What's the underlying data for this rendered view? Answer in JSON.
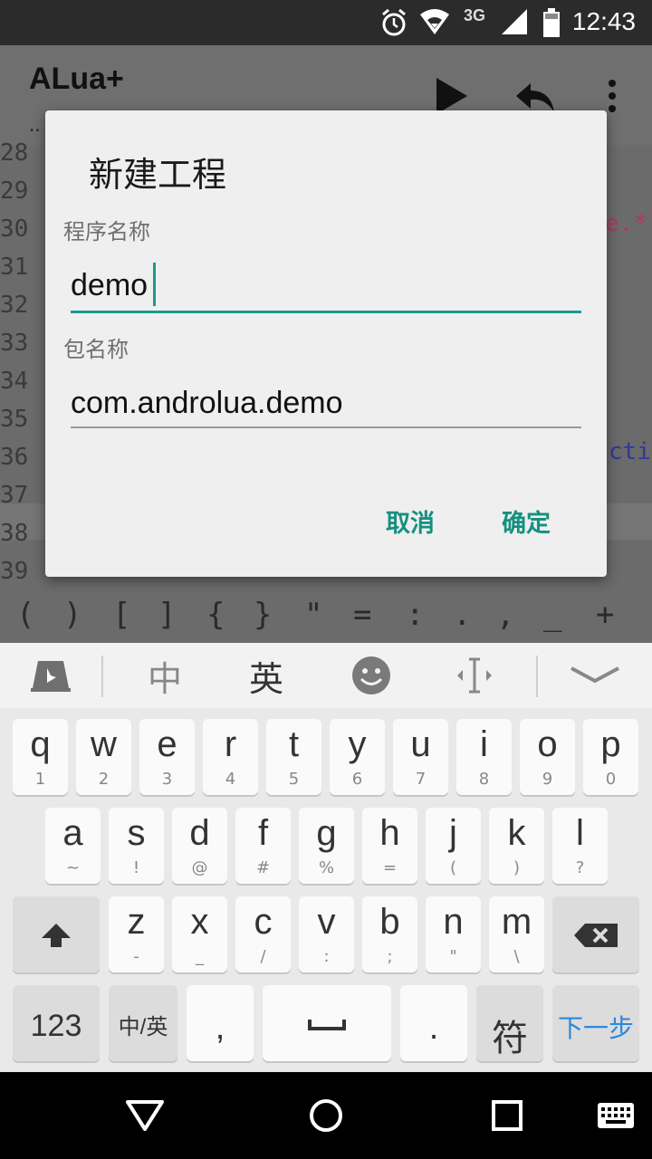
{
  "status_bar": {
    "time": "12:43",
    "network": "3G"
  },
  "app_bar": {
    "title": "ALua+",
    "subtitle": ".."
  },
  "editor": {
    "line_numbers": [
      "28",
      "29",
      "30",
      "31",
      "32",
      "33",
      "34",
      "35",
      "36",
      "37",
      "38",
      "39"
    ],
    "fragments": [
      {
        "text": "e.*",
        "color": "#b03a5a"
      },
      {
        "text": "cti",
        "color": "#2d3a9a"
      },
      {
        "text": "--",
        "color": "#8a1a1a"
      }
    ]
  },
  "symbol_bar": {
    "symbols": [
      "(",
      ")",
      "[",
      "]",
      "{",
      "}",
      "\"",
      "=",
      ":",
      ".",
      ",",
      "_",
      "+"
    ]
  },
  "dialog": {
    "title": "新建工程",
    "program_name_label": "程序名称",
    "program_name_value": "demo",
    "package_name_label": "包名称",
    "package_name_value": "com.androlua.demo",
    "cancel_label": "取消",
    "ok_label": "确定",
    "accent_color": "#1a9a8c"
  },
  "keyboard": {
    "toolbar": {
      "chinese_label": "中",
      "english_label": "英"
    },
    "rows": [
      [
        [
          "q",
          "1"
        ],
        [
          "w",
          "2"
        ],
        [
          "e",
          "3"
        ],
        [
          "r",
          "4"
        ],
        [
          "t",
          "5"
        ],
        [
          "y",
          "6"
        ],
        [
          "u",
          "7"
        ],
        [
          "i",
          "8"
        ],
        [
          "o",
          "9"
        ],
        [
          "p",
          "0"
        ]
      ],
      [
        [
          "a",
          "~"
        ],
        [
          "s",
          "!"
        ],
        [
          "d",
          "@"
        ],
        [
          "f",
          "#"
        ],
        [
          "g",
          "%"
        ],
        [
          "h",
          "="
        ],
        [
          "j",
          "("
        ],
        [
          "k",
          ")"
        ],
        [
          "l",
          "?"
        ]
      ],
      [
        [
          "z",
          "-"
        ],
        [
          "x",
          "_"
        ],
        [
          "c",
          "/"
        ],
        [
          "v",
          ":"
        ],
        [
          "b",
          ";"
        ],
        [
          "n",
          "\""
        ],
        [
          "m",
          "\\"
        ]
      ]
    ],
    "bottom": {
      "numbers_label": "123",
      "lang_switch_label": "中/英",
      "comma_label": ",",
      "period_label": ".",
      "symbols_label": "符",
      "next_label": "下一步"
    }
  }
}
